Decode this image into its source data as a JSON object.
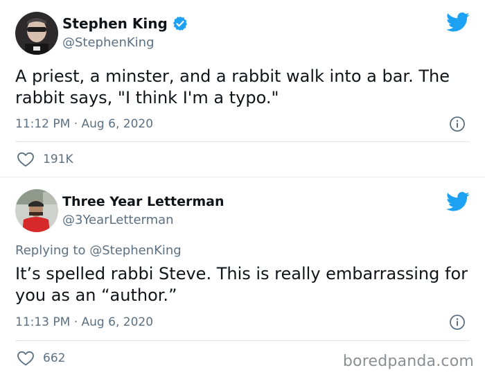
{
  "tweets": [
    {
      "name": "Stephen King",
      "verified": true,
      "handle": "@StephenKing",
      "text": "A priest, a minster, and a rabbit walk into a bar. The rabbit says, \"I think I'm a typo.\"",
      "timestamp": "11:12 PM · Aug 6, 2020",
      "likes": "191K"
    },
    {
      "name": "Three Year Letterman",
      "handle": "@3YearLetterman",
      "replying_label": "Replying to",
      "replying_to": "@StephenKing",
      "text": "It’s spelled rabbi Steve. This is really embarrassing for you as an “author.”",
      "timestamp": "11:13 PM · Aug 6, 2020",
      "likes": "662"
    }
  ],
  "watermark": "boredpanda.com",
  "colors": {
    "twitter_blue": "#1da1f2",
    "secondary_text": "#5b7083",
    "divider": "#dfe6ea"
  },
  "icons": [
    "twitter-bird-icon",
    "verified-badge-icon",
    "info-icon",
    "heart-icon"
  ]
}
